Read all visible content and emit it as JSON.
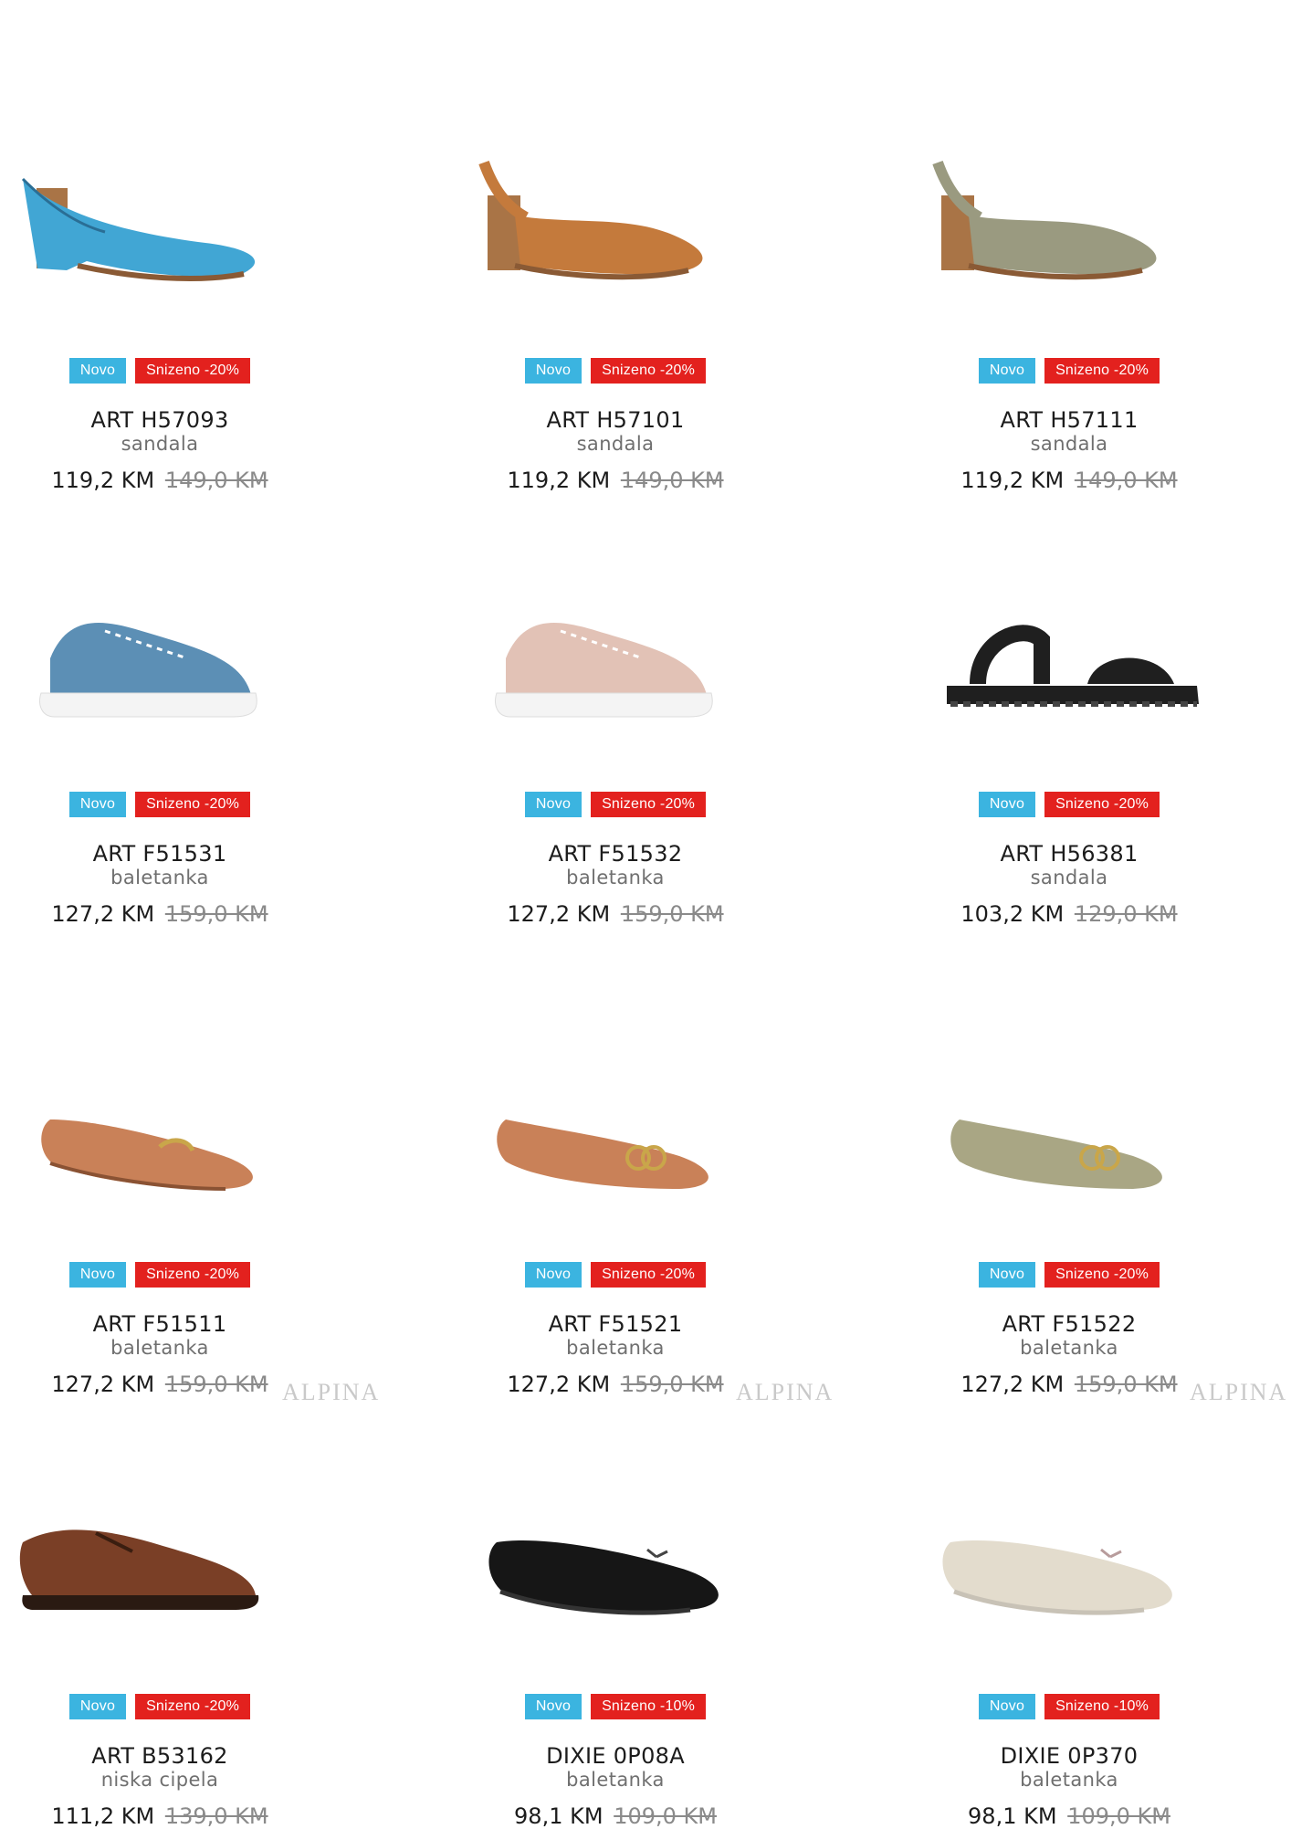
{
  "products": [
    {
      "name": "ART H57093",
      "type": "sandala",
      "badge_new": "Novo",
      "badge_sale": "Snizeno -20%",
      "price": "119,2 KM",
      "old_price": "149,0 KM",
      "color": "#41a6d4",
      "icon": "heeled-peep-toe-sandal"
    },
    {
      "name": "ART H57101",
      "type": "sandala",
      "badge_new": "Novo",
      "badge_sale": "Snizeno -20%",
      "price": "119,2 KM",
      "old_price": "149,0 KM",
      "color": "#c47a3c",
      "icon": "heeled-slingback-sandal"
    },
    {
      "name": "ART H57111",
      "type": "sandala",
      "badge_new": "Novo",
      "badge_sale": "Snizeno -20%",
      "price": "119,2 KM",
      "old_price": "149,0 KM",
      "color": "#9a9a80",
      "icon": "heeled-slingback-sandal"
    },
    {
      "name": "ART F51531",
      "type": "baletanka",
      "badge_new": "Novo",
      "badge_sale": "Snizeno -20%",
      "price": "127,2 KM",
      "old_price": "159,0 KM",
      "color": "#5c8fb5",
      "icon": "sneaker"
    },
    {
      "name": "ART F51532",
      "type": "baletanka",
      "badge_new": "Novo",
      "badge_sale": "Snizeno -20%",
      "price": "127,2 KM",
      "old_price": "159,0 KM",
      "color": "#e2c2b6",
      "icon": "sneaker"
    },
    {
      "name": "ART H56381",
      "type": "sandala",
      "badge_new": "Novo",
      "badge_sale": "Snizeno -20%",
      "price": "103,2 KM",
      "old_price": "129,0 KM",
      "color": "#1f1f1f",
      "icon": "flat-strap-sandal"
    },
    {
      "name": "ART F51511",
      "type": "baletanka",
      "badge_new": "Novo",
      "badge_sale": "Snizeno -20%",
      "price": "127,2 KM",
      "old_price": "159,0 KM",
      "color": "#c98158",
      "icon": "loafer"
    },
    {
      "name": "ART F51521",
      "type": "baletanka",
      "badge_new": "Novo",
      "badge_sale": "Snizeno -20%",
      "price": "127,2 KM",
      "old_price": "159,0 KM",
      "color": "#c98158",
      "icon": "ballet-flat"
    },
    {
      "name": "ART F51522",
      "type": "baletanka",
      "badge_new": "Novo",
      "badge_sale": "Snizeno -20%",
      "price": "127,2 KM",
      "old_price": "159,0 KM",
      "color": "#a9a684",
      "icon": "ballet-flat"
    },
    {
      "name": "ART B53162",
      "type": "niska cipela",
      "badge_new": "Novo",
      "badge_sale": "Snizeno -20%",
      "price": "111,2 KM",
      "old_price": "139,0 KM",
      "color": "#7a3f26",
      "icon": "derby-shoe"
    },
    {
      "name": "DIXIE 0P08A",
      "type": "baletanka",
      "badge_new": "Novo",
      "badge_sale": "Snizeno -10%",
      "price": "98,1 KM",
      "old_price": "109,0 KM",
      "color": "#161616",
      "icon": "bow-ballet-flat"
    },
    {
      "name": "DIXIE 0P370",
      "type": "baletanka",
      "badge_new": "Novo",
      "badge_sale": "Snizeno -10%",
      "price": "98,1 KM",
      "old_price": "109,0 KM",
      "color": "#e3dccd",
      "icon": "bow-ballet-flat"
    }
  ],
  "watermark_text": "ALPINA",
  "colors": {
    "badge_new": "#3bb4e0",
    "badge_sale": "#e3211e"
  }
}
